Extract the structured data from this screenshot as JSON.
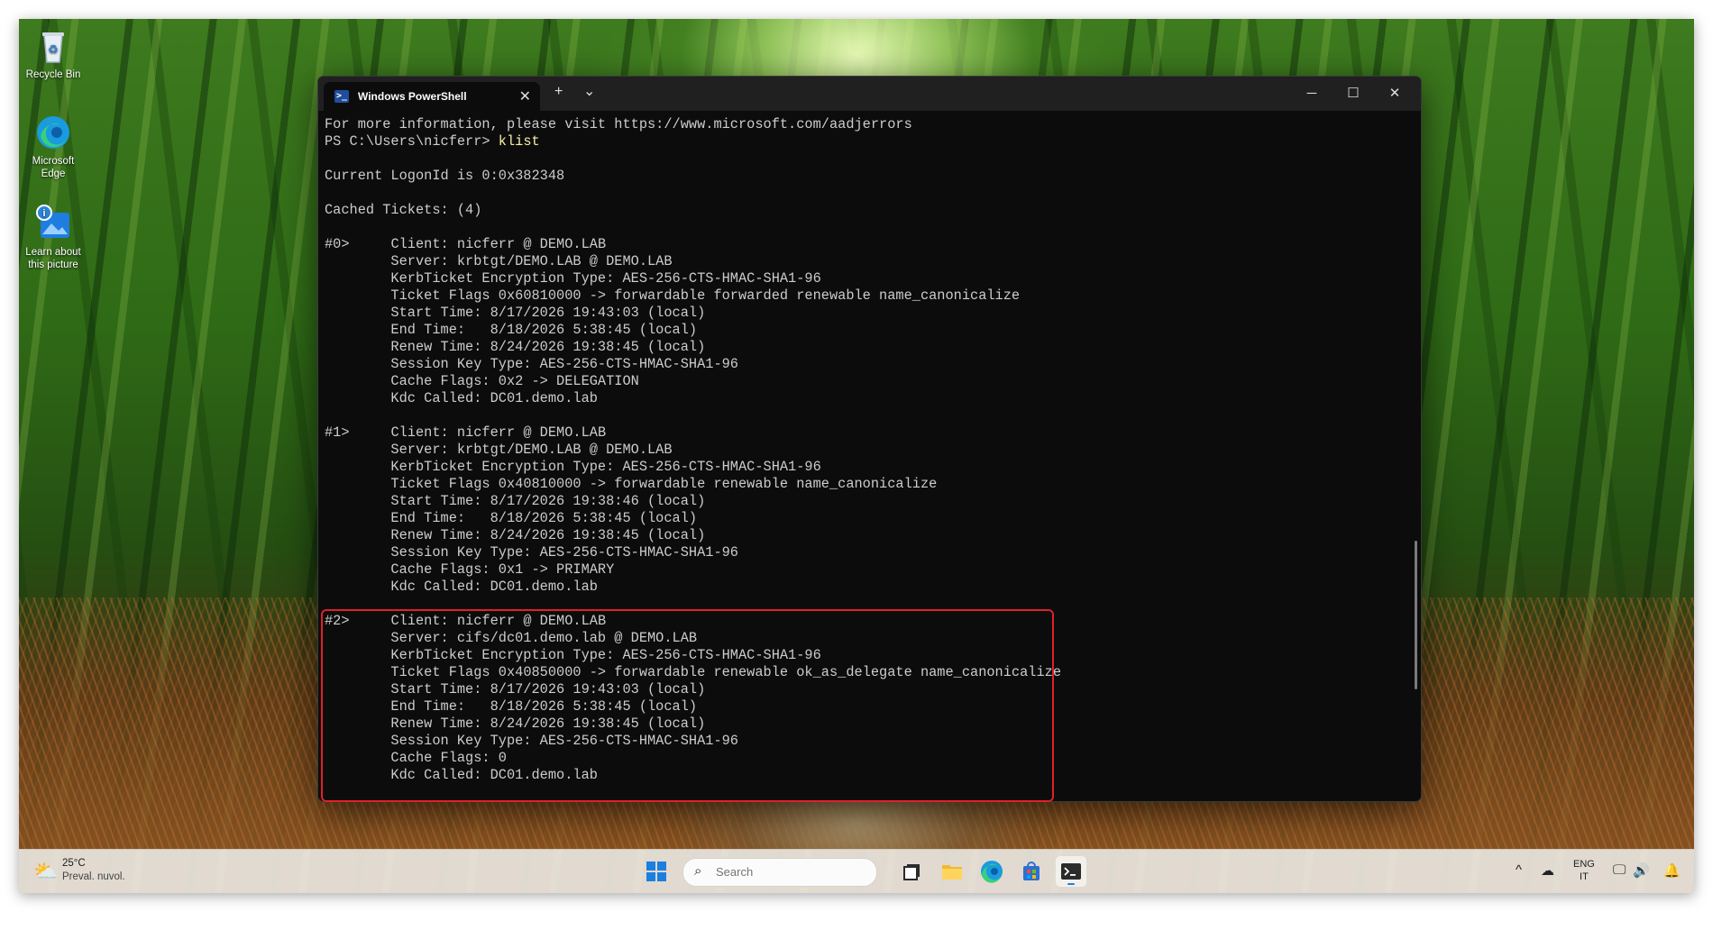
{
  "desktop": {
    "icons": [
      {
        "label": "Recycle Bin",
        "icon": "recycle-bin-icon"
      },
      {
        "label": "Microsoft Edge",
        "icon": "edge-icon"
      },
      {
        "label": "Learn about this picture",
        "icon": "info-picture-icon"
      }
    ]
  },
  "window": {
    "tab_title": "Windows PowerShell",
    "new_tab": "+",
    "dropdown": "⌄",
    "minimize": "─",
    "maximize": "☐",
    "close": "✕",
    "tab_close": "✕"
  },
  "terminal": {
    "intro_line": "For more information, please visit https://www.microsoft.com/aadjerrors",
    "prompt": "PS C:\\Users\\nicferr> ",
    "command": "klist",
    "logon_line": "Current LogonId is 0:0x382348",
    "cached_line": "Cached Tickets: (4)",
    "tickets": [
      {
        "index": "#0>",
        "client": "nicferr @ DEMO.LAB",
        "server": "krbtgt/DEMO.LAB @ DEMO.LAB",
        "enc_type": "AES-256-CTS-HMAC-SHA1-96",
        "flags": "0x60810000 -> forwardable forwarded renewable name_canonicalize",
        "start": "8/17/2026 19:43:03 (local)",
        "end": "8/18/2026 5:38:45 (local)",
        "renew": "8/24/2026 19:38:45 (local)",
        "session_key": "AES-256-CTS-HMAC-SHA1-96",
        "cache_flags": "0x2 -> DELEGATION",
        "kdc": "DC01.demo.lab"
      },
      {
        "index": "#1>",
        "client": "nicferr @ DEMO.LAB",
        "server": "krbtgt/DEMO.LAB @ DEMO.LAB",
        "enc_type": "AES-256-CTS-HMAC-SHA1-96",
        "flags": "0x40810000 -> forwardable renewable name_canonicalize",
        "start": "8/17/2026 19:38:46 (local)",
        "end": "8/18/2026 5:38:45 (local)",
        "renew": "8/24/2026 19:38:45 (local)",
        "session_key": "AES-256-CTS-HMAC-SHA1-96",
        "cache_flags": "0x1 -> PRIMARY",
        "kdc": "DC01.demo.lab"
      },
      {
        "index": "#2>",
        "client": "nicferr @ DEMO.LAB",
        "server": "cifs/dc01.demo.lab @ DEMO.LAB",
        "enc_type": "AES-256-CTS-HMAC-SHA1-96",
        "flags": "0x40850000 -> forwardable renewable ok_as_delegate name_canonicalize",
        "start": "8/17/2026 19:43:03 (local)",
        "end": "8/18/2026 5:38:45 (local)",
        "renew": "8/24/2026 19:38:45 (local)",
        "session_key": "AES-256-CTS-HMAC-SHA1-96",
        "cache_flags": "0",
        "kdc": "DC01.demo.lab"
      }
    ]
  },
  "taskbar": {
    "weather_temp": "25°C",
    "weather_desc": "Preval. nuvol.",
    "search_placeholder": "Search",
    "lang_top": "ENG",
    "lang_bottom": "IT"
  },
  "colors": {
    "terminal_bg": "#0c0c0c",
    "terminal_fg": "#cccccc",
    "command": "#f9f1a5",
    "highlight": "#e0202a"
  }
}
